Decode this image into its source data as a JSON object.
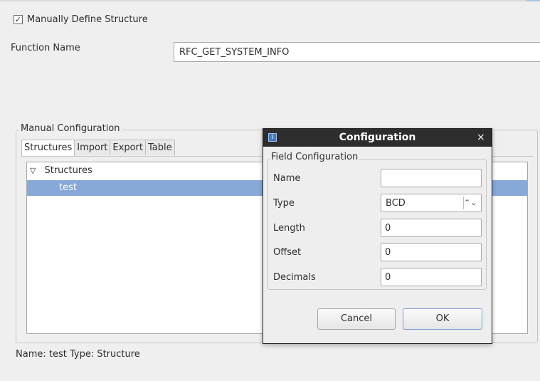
{
  "header": {
    "checkbox_label": "Manually Define Structure",
    "checkbox_checked": true,
    "function_name_label": "Function Name",
    "function_name_value": "RFC_GET_SYSTEM_INFO"
  },
  "manual": {
    "legend": "Manual Configuration",
    "tabs": [
      {
        "label": "Structures",
        "active": true
      },
      {
        "label": "Import",
        "active": false
      },
      {
        "label": "Export",
        "active": false
      },
      {
        "label": "Table",
        "active": false
      }
    ],
    "tree": {
      "root": "Structures",
      "children": [
        "test"
      ]
    }
  },
  "status_text": "Name: test Type: Structure",
  "dialog": {
    "title": "Configuration",
    "close_glyph": "×",
    "icon": "app-icon",
    "group_legend": "Field Configuration",
    "fields": {
      "name_label": "Name",
      "name_value": "",
      "type_label": "Type",
      "type_value": "BCD",
      "length_label": "Length",
      "length_value": "0",
      "offset_label": "Offset",
      "offset_value": "0",
      "decimals_label": "Decimals",
      "decimals_value": "0"
    },
    "cancel_label": "Cancel",
    "ok_label": "OK"
  },
  "colors": {
    "selection": "#87a9d8",
    "title_bar": "#2d2d2d",
    "background": "#efefef"
  }
}
